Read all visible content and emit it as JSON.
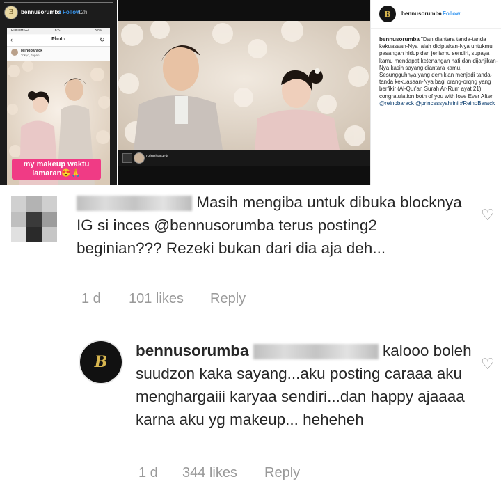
{
  "story": {
    "username": "bennusorumba",
    "follow": "• Follow",
    "time": "12h",
    "phone_status_carrier": "TELKOMSEL",
    "phone_status_time": "18:57",
    "phone_status_battery": "32%",
    "screen_title": "Photo",
    "post_username": "reinobarack",
    "post_location": "Tokyo, Japan",
    "caption_line1": "my makeup waktu",
    "caption_line2": "lamaran😍🙏"
  },
  "post": {
    "overlay_username": "reinobarack"
  },
  "caption_panel": {
    "username": "bennusorumba",
    "dot": "•",
    "follow": "Follow",
    "caption_user": "bennusorumba",
    "caption_text": "\"Dan diantara tanda-tanda kekuasaan-Nya ialah diciptakan-Nya untukmu pasangan hidup dari jenismu sendiri, supaya kamu mendapat ketenangan hati dan dijanjikan-Nya kasih sayang diantara kamu. Sesungguhnya yang demikian menjadi tanda-tanda kekuasaan-Nya bagi orang-orqng yang berfikir (Al-Qur'an Surah Ar-Rum ayat 21) congratulation both of you with love Ever After",
    "mention1": "@reinobarack",
    "mention2": "@princessyahrini",
    "hashtag": "#ReinoBarack"
  },
  "comments": [
    {
      "text_part1": "Masih mengiba untuk dibuka blocknya IG si inces",
      "mention": "@bennusorumba",
      "text_part2": "terus posting2 beginian??? Rezeki bukan dari dia aja deh...",
      "age": "1 d",
      "likes": "101 likes",
      "reply": "Reply"
    },
    {
      "username": "bennusorumba",
      "text": "kalooo boleh suudzon kaka sayang...aku posting caraaa aku menghargaiii karyaa sendiri...dan happy ajaaaa karna aku yg makeup... heheheh",
      "age": "1 d",
      "likes": "344 likes",
      "reply": "Reply"
    }
  ],
  "icons": {
    "brand_mark": "bennusorumba-logo-icon",
    "heart": "heart-outline-icon"
  },
  "colors": {
    "instagram_blue": "#3897f0",
    "caption_pink": "#f03b85",
    "mention_link": "#003569",
    "meta_gray": "#999999"
  }
}
